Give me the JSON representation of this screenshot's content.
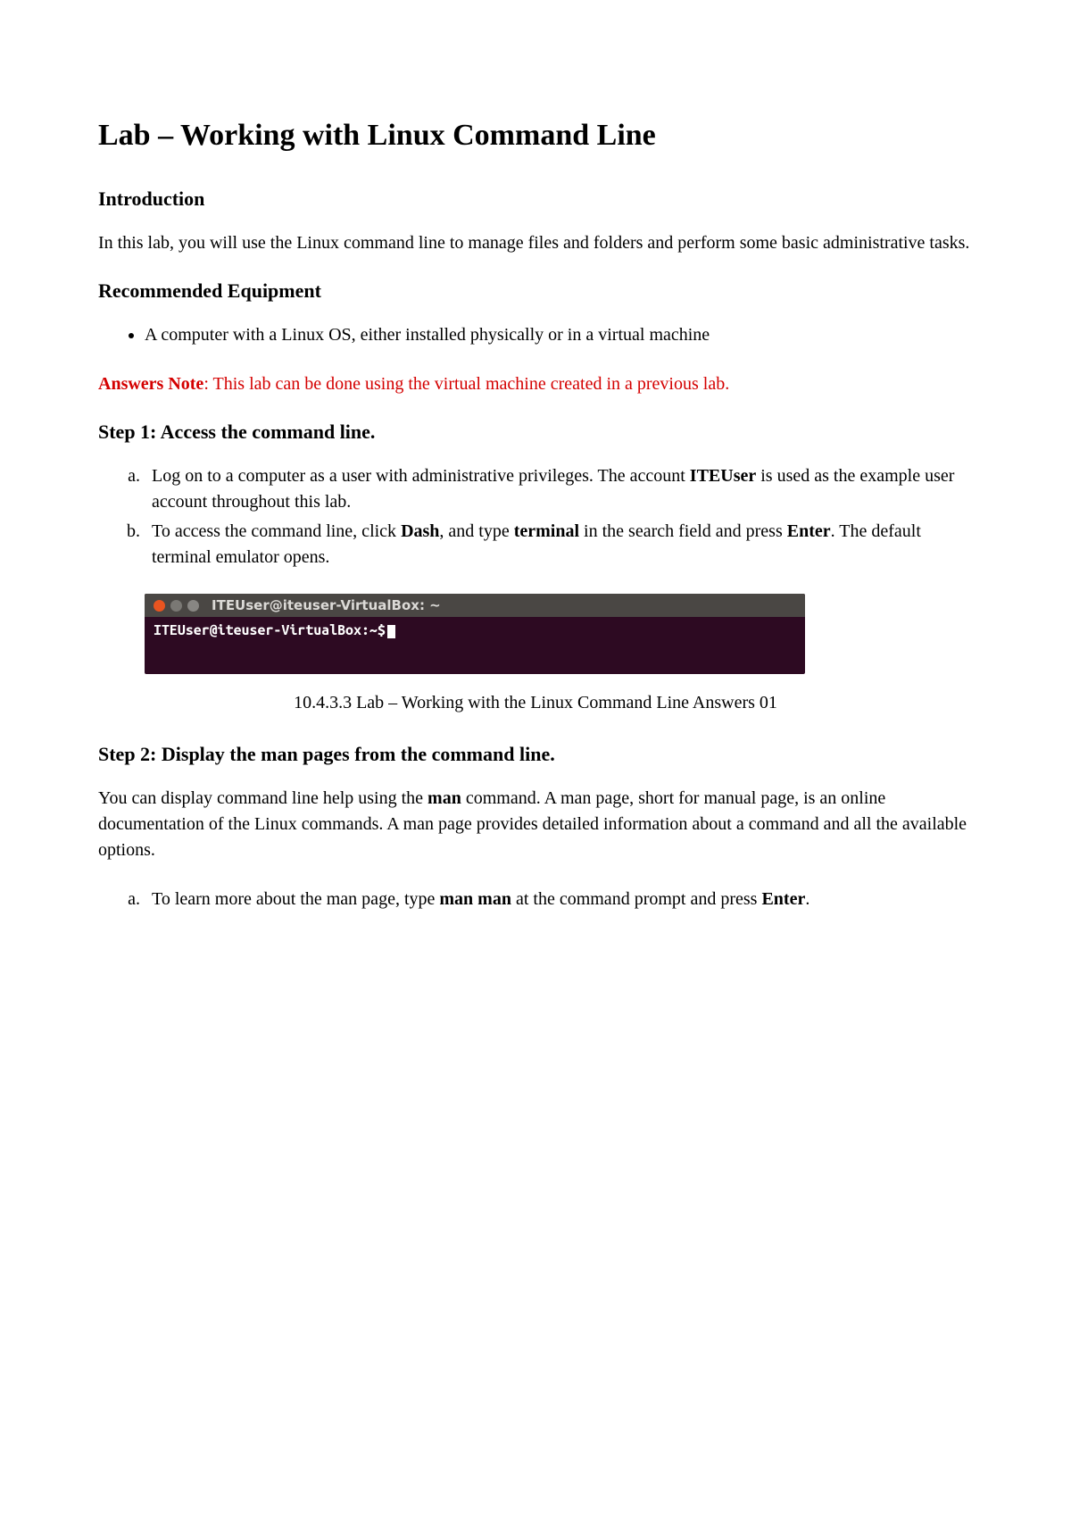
{
  "title": "Lab – Working with Linux Command Line",
  "intro": {
    "heading": "Introduction",
    "text": "In this lab, you will use the Linux command line to manage files and folders and perform some basic administrative tasks."
  },
  "equipment": {
    "heading": "Recommended Equipment",
    "items": [
      "A computer with a Linux OS, either installed physically or in a virtual machine"
    ]
  },
  "note": {
    "label": "Answers Note",
    "text": ": This lab can be done using the virtual machine created in a previous lab."
  },
  "step1": {
    "heading": "Step 1: Access the command line.",
    "a_pre": "Log on to a computer as a user with administrative privileges. The account ",
    "a_bold": "ITEUser",
    "a_post": " is used as the example user account throughout this lab.",
    "b_pre": "To access the command line, click ",
    "b_bold1": "Dash",
    "b_mid": ", and type ",
    "b_bold2": "terminal",
    "b_mid2": " in the search field and press ",
    "b_bold3": "Enter",
    "b_post": ". The default terminal emulator opens."
  },
  "terminal": {
    "title": "ITEUser@iteuser-VirtualBox: ~",
    "prompt": "ITEUser@iteuser-VirtualBox:~$"
  },
  "caption": "10.4.3.3 Lab – Working with the Linux Command Line Answers 01",
  "step2": {
    "heading": "Step 2: Display the man pages from the command line.",
    "p_pre": "You can display command line help using the ",
    "p_bold": "man",
    "p_post": " command. A man page, short for manual page, is an online documentation of the Linux commands. A man page provides detailed information about a command and all the available options.",
    "a_pre": "To learn more about the man page, type ",
    "a_bold1": "man man",
    "a_mid": " at the command prompt and press ",
    "a_bold2": "Enter",
    "a_post": "."
  }
}
